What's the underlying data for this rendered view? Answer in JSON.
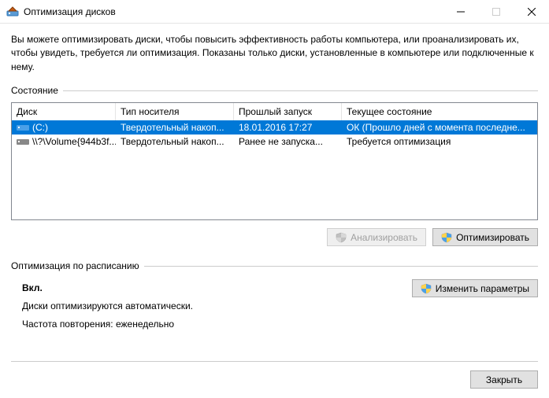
{
  "window": {
    "title": "Оптимизация дисков"
  },
  "intro": "Вы можете оптимизировать диски, чтобы повысить эффективность работы  компьютера, или проанализировать их, чтобы увидеть, требуется ли оптимизация. Показаны только диски, установленные в компьютере или подключенные к нему.",
  "state_label": "Состояние",
  "columns": {
    "disk": "Диск",
    "media": "Тип носителя",
    "last_run": "Прошлый запуск",
    "status": "Текущее состояние"
  },
  "rows": [
    {
      "disk": "(C:)",
      "media": "Твердотельный накоп...",
      "last_run": "18.01.2016 17:27",
      "status": "ОК (Прошло дней с момента последне...",
      "selected": true,
      "icon": "drive-blue"
    },
    {
      "disk": "\\\\?\\Volume{944b3f...",
      "media": "Твердотельный накоп...",
      "last_run": "Ранее не запуска...",
      "status": "Требуется оптимизация",
      "selected": false,
      "icon": "drive-gray"
    }
  ],
  "buttons": {
    "analyze": "Анализировать",
    "optimize": "Оптимизировать",
    "change_settings": "Изменить параметры",
    "close": "Закрыть"
  },
  "schedule": {
    "heading": "Оптимизация по расписанию",
    "on": "Вкл.",
    "line1": "Диски оптимизируются автоматически.",
    "line2": "Частота повторения: еженедельно"
  }
}
